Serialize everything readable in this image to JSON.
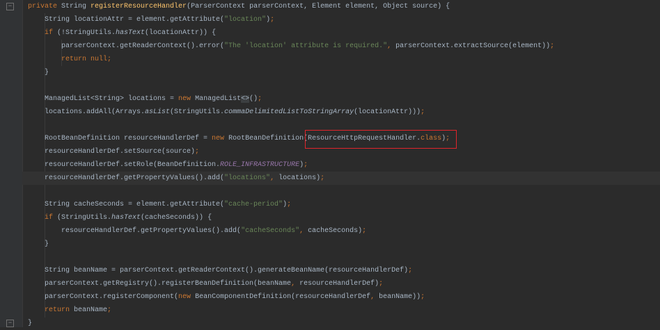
{
  "code": {
    "lines": [
      [
        [
          "kw",
          "private "
        ],
        [
          "",
          "String "
        ],
        [
          "decl",
          "registerResourceHandler"
        ],
        [
          "",
          "(ParserContext parserContext, Element element, Object source) {"
        ]
      ],
      [
        [
          "",
          "    String locationAttr = element.getAttribute("
        ],
        [
          "str",
          "\"location\""
        ],
        [
          "",
          ")"
        ],
        [
          "kw",
          ";"
        ]
      ],
      [
        [
          "kw",
          "    if "
        ],
        [
          "",
          "(!StringUtils."
        ],
        [
          "it",
          "hasText"
        ],
        [
          "",
          "(locationAttr)) {"
        ]
      ],
      [
        [
          "",
          "        parserContext.getReaderContext().error("
        ],
        [
          "str",
          "\"The 'location' attribute is required.\""
        ],
        [
          "kw",
          ", "
        ],
        [
          "",
          "parserContext.extractSource(element))"
        ],
        [
          "kw",
          ";"
        ]
      ],
      [
        [
          "kw",
          "        return null;"
        ]
      ],
      [
        [
          "",
          "    }"
        ]
      ],
      [],
      [
        [
          "",
          "    ManagedList<String> locations = "
        ],
        [
          "kw",
          "new "
        ],
        [
          "",
          "ManagedList"
        ],
        [
          "gen",
          "<>"
        ],
        [
          "",
          "()"
        ],
        [
          "kw",
          ";"
        ]
      ],
      [
        [
          "",
          "    locations.addAll(Arrays."
        ],
        [
          "it",
          "asList"
        ],
        [
          "",
          "(StringUtils."
        ],
        [
          "it",
          "commaDelimitedListToStringArray"
        ],
        [
          "",
          "(locationAttr)))"
        ],
        [
          "kw",
          ";"
        ]
      ],
      [],
      [
        [
          "",
          "    RootBeanDefinition resourceHandlerDef = "
        ],
        [
          "kw",
          "new "
        ],
        [
          "",
          "RootBeanDefinition(ResourceHttpRequestHandler."
        ],
        [
          "kw",
          "class"
        ],
        [
          "",
          ")"
        ],
        [
          "kw",
          ";"
        ]
      ],
      [
        [
          "",
          "    resourceHandlerDef.setSource(source)"
        ],
        [
          "kw",
          ";"
        ]
      ],
      [
        [
          "",
          "    resourceHandlerDef.setRole(BeanDefinition."
        ],
        [
          "const",
          "ROLE_INFRASTRUCTURE"
        ],
        [
          "",
          ")"
        ],
        [
          "kw",
          ";"
        ]
      ],
      [
        [
          "",
          "    resourceHandlerDef.getPropertyValues().add("
        ],
        [
          "str",
          "\"locations\""
        ],
        [
          "kw",
          ", "
        ],
        [
          "",
          "locations)"
        ],
        [
          "kw",
          ";"
        ]
      ],
      [],
      [
        [
          "",
          "    String cacheSeconds = element.getAttribute("
        ],
        [
          "str",
          "\"cache-period\""
        ],
        [
          "",
          ")"
        ],
        [
          "kw",
          ";"
        ]
      ],
      [
        [
          "kw",
          "    if "
        ],
        [
          "",
          "(StringUtils."
        ],
        [
          "it",
          "hasText"
        ],
        [
          "",
          "(cacheSeconds)) {"
        ]
      ],
      [
        [
          "",
          "        resourceHandlerDef.getPropertyValues().add("
        ],
        [
          "str",
          "\"cacheSeconds\""
        ],
        [
          "kw",
          ", "
        ],
        [
          "",
          "cacheSeconds)"
        ],
        [
          "kw",
          ";"
        ]
      ],
      [
        [
          "",
          "    }"
        ]
      ],
      [],
      [
        [
          "",
          "    String beanName = parserContext.getReaderContext().generateBeanName(resourceHandlerDef)"
        ],
        [
          "kw",
          ";"
        ]
      ],
      [
        [
          "",
          "    parserContext.getRegistry().registerBeanDefinition(beanName"
        ],
        [
          "kw",
          ", "
        ],
        [
          "",
          "resourceHandlerDef)"
        ],
        [
          "kw",
          ";"
        ]
      ],
      [
        [
          "",
          "    parserContext.registerComponent("
        ],
        [
          "kw",
          "new "
        ],
        [
          "",
          "BeanComponentDefinition(resourceHandlerDef"
        ],
        [
          "kw",
          ", "
        ],
        [
          "",
          "beanName))"
        ],
        [
          "kw",
          ";"
        ]
      ],
      [
        [
          "kw",
          "    return "
        ],
        [
          "",
          "beanName"
        ],
        [
          "kw",
          ";"
        ]
      ],
      [
        [
          "",
          "}"
        ]
      ]
    ],
    "current_line": 13,
    "highlighted_text": "ResourceHttpRequestHandler.class);"
  },
  "colors": {
    "background": "#2b2b2b",
    "keyword": "#cc7832",
    "string": "#6a8759",
    "method": "#ffc66d",
    "constant": "#9876aa",
    "text": "#a9b7c6",
    "highlight_box": "#e0252b"
  }
}
